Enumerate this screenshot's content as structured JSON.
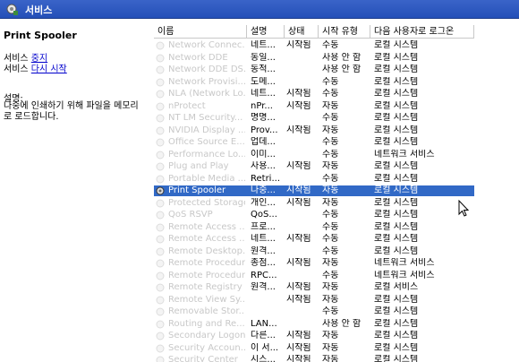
{
  "window": {
    "title": "서비스",
    "icon": "services-gear-icon"
  },
  "left_panel": {
    "service_name": "Print Spooler",
    "action1_prefix": "서비스 ",
    "action1_link": "중지",
    "action2_prefix": "서비스 ",
    "action2_link": "다시 시작",
    "desc_label": "설명:",
    "description": "나중에 인쇄하기 위해 파일을 메모리로 로드합니다."
  },
  "columns": [
    "이름",
    "설명",
    "상태",
    "시작 유형",
    "다음 사용자로 로그온"
  ],
  "rows": [
    {
      "name": "Network Connec...",
      "desc": "네트...",
      "status": "시작됨",
      "startup": "수동",
      "logon": "로컬 시스템"
    },
    {
      "name": "Network DDE",
      "desc": "동일...",
      "status": "",
      "startup": "사용 안 함",
      "logon": "로컬 시스템"
    },
    {
      "name": "Network DDE DS...",
      "desc": "동적...",
      "status": "",
      "startup": "사용 안 함",
      "logon": "로컬 시스템"
    },
    {
      "name": "Network Provisi...",
      "desc": "도메...",
      "status": "",
      "startup": "수동",
      "logon": "로컬 시스템"
    },
    {
      "name": "NLA (Network Lo...",
      "desc": "네트...",
      "status": "시작됨",
      "startup": "수동",
      "logon": "로컬 시스템"
    },
    {
      "name": "nProtect",
      "desc": "nPr...",
      "status": "시작됨",
      "startup": "자동",
      "logon": "로컬 시스템"
    },
    {
      "name": "NT LM Security...",
      "desc": "명명...",
      "status": "",
      "startup": "수동",
      "logon": "로컬 시스템"
    },
    {
      "name": "NVIDIA Display ...",
      "desc": "Prov...",
      "status": "시작됨",
      "startup": "자동",
      "logon": "로컬 시스템"
    },
    {
      "name": "Office Source E...",
      "desc": "업데...",
      "status": "",
      "startup": "수동",
      "logon": "로컬 시스템"
    },
    {
      "name": "Performance Lo...",
      "desc": "이미...",
      "status": "",
      "startup": "수동",
      "logon": "네트워크 서비스"
    },
    {
      "name": "Plug and Play",
      "desc": "사용...",
      "status": "시작됨",
      "startup": "자동",
      "logon": "로컬 시스템"
    },
    {
      "name": "Portable Media ...",
      "desc": "Retri...",
      "status": "",
      "startup": "수동",
      "logon": "로컬 시스템"
    },
    {
      "name": "Print Spooler",
      "desc": "나중...",
      "status": "시작됨",
      "startup": "자동",
      "logon": "로컬 시스템",
      "selected": true
    },
    {
      "name": "Protected Storage",
      "desc": "개인...",
      "status": "시작됨",
      "startup": "자동",
      "logon": "로컬 시스템"
    },
    {
      "name": "QoS RSVP",
      "desc": "QoS...",
      "status": "",
      "startup": "수동",
      "logon": "로컬 시스템"
    },
    {
      "name": "Remote Access ...",
      "desc": "프로...",
      "status": "",
      "startup": "수동",
      "logon": "로컬 시스템"
    },
    {
      "name": "Remote Access ...",
      "desc": "네트...",
      "status": "시작됨",
      "startup": "수동",
      "logon": "로컬 시스템"
    },
    {
      "name": "Remote Desktop...",
      "desc": "원격...",
      "status": "",
      "startup": "수동",
      "logon": "로컬 시스템"
    },
    {
      "name": "Remote Procedur...",
      "desc": "종점...",
      "status": "시작됨",
      "startup": "자동",
      "logon": "네트워크 서비스"
    },
    {
      "name": "Remote Procedur...",
      "desc": "RPC...",
      "status": "",
      "startup": "수동",
      "logon": "네트워크 서비스"
    },
    {
      "name": "Remote Registry",
      "desc": "원격...",
      "status": "시작됨",
      "startup": "자동",
      "logon": "로컬 서비스"
    },
    {
      "name": "Remote View Sy...",
      "desc": "",
      "status": "시작됨",
      "startup": "자동",
      "logon": "로컬 시스템"
    },
    {
      "name": "Removable Stor...",
      "desc": "",
      "status": "",
      "startup": "수동",
      "logon": "로컬 시스템"
    },
    {
      "name": "Routing and Re...",
      "desc": "LAN...",
      "status": "",
      "startup": "사용 안 함",
      "logon": "로컬 시스템"
    },
    {
      "name": "Secondary Logon",
      "desc": "다른...",
      "status": "시작됨",
      "startup": "자동",
      "logon": "로컬 시스템"
    },
    {
      "name": "Security Accoun...",
      "desc": "이 서...",
      "status": "시작됨",
      "startup": "자동",
      "logon": "로컬 시스템"
    },
    {
      "name": "Security Center",
      "desc": "시스...",
      "status": "시작됨",
      "startup": "자동",
      "logon": "로컬 시스템"
    }
  ]
}
